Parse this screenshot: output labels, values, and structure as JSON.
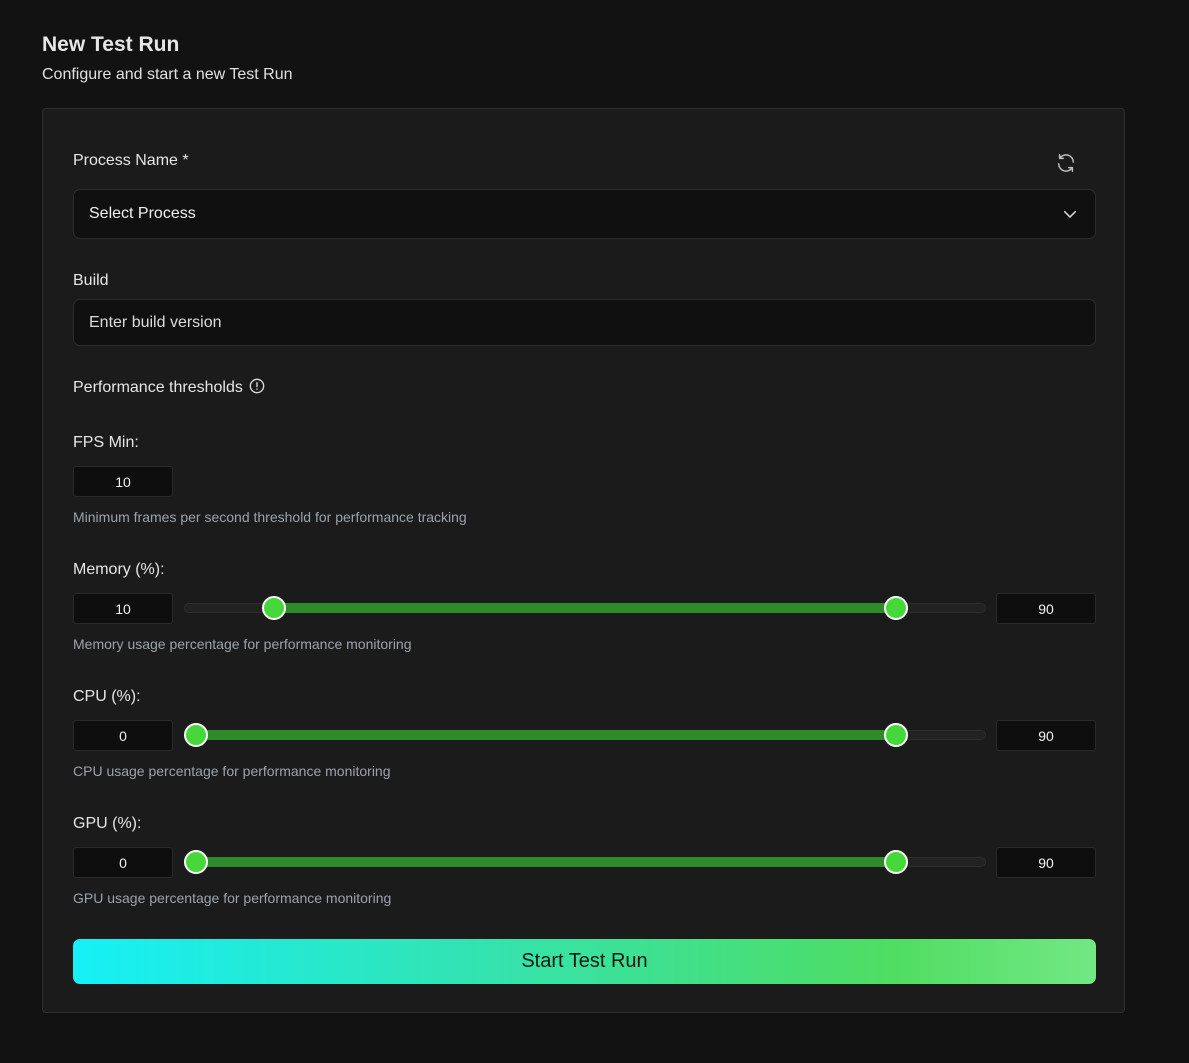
{
  "header": {
    "title": "New Test Run",
    "subtitle": "Configure and start a new Test Run"
  },
  "form": {
    "process": {
      "label": "Process Name *",
      "selected_value": "Select Process",
      "refresh_icon": "refresh-icon",
      "chevron_icon": "chevron-down-icon"
    },
    "build": {
      "label": "Build",
      "placeholder": "Enter build version",
      "value": ""
    },
    "thresholds": {
      "heading": "Performance thresholds",
      "info_icon": "info-icon",
      "fps": {
        "label": "FPS Min:",
        "value": "10",
        "hint": "Minimum frames per second threshold for performance tracking"
      },
      "memory": {
        "label": "Memory (%):",
        "min": "10",
        "max": "90",
        "hint": "Memory usage percentage for performance monitoring"
      },
      "cpu": {
        "label": "CPU (%):",
        "min": "0",
        "max": "90",
        "hint": "CPU usage percentage for performance monitoring"
      },
      "gpu": {
        "label": "GPU (%):",
        "min": "0",
        "max": "90",
        "hint": "GPU usage percentage for performance monitoring"
      }
    },
    "submit_label": "Start Test Run"
  },
  "colors": {
    "page_bg": "#121212",
    "card_bg": "#1b1b1b",
    "slider_range": "#2f8a2a",
    "slider_thumb": "#46d83a",
    "button_gradient_start": "#16f0f7",
    "button_gradient_end": "#72e884"
  }
}
